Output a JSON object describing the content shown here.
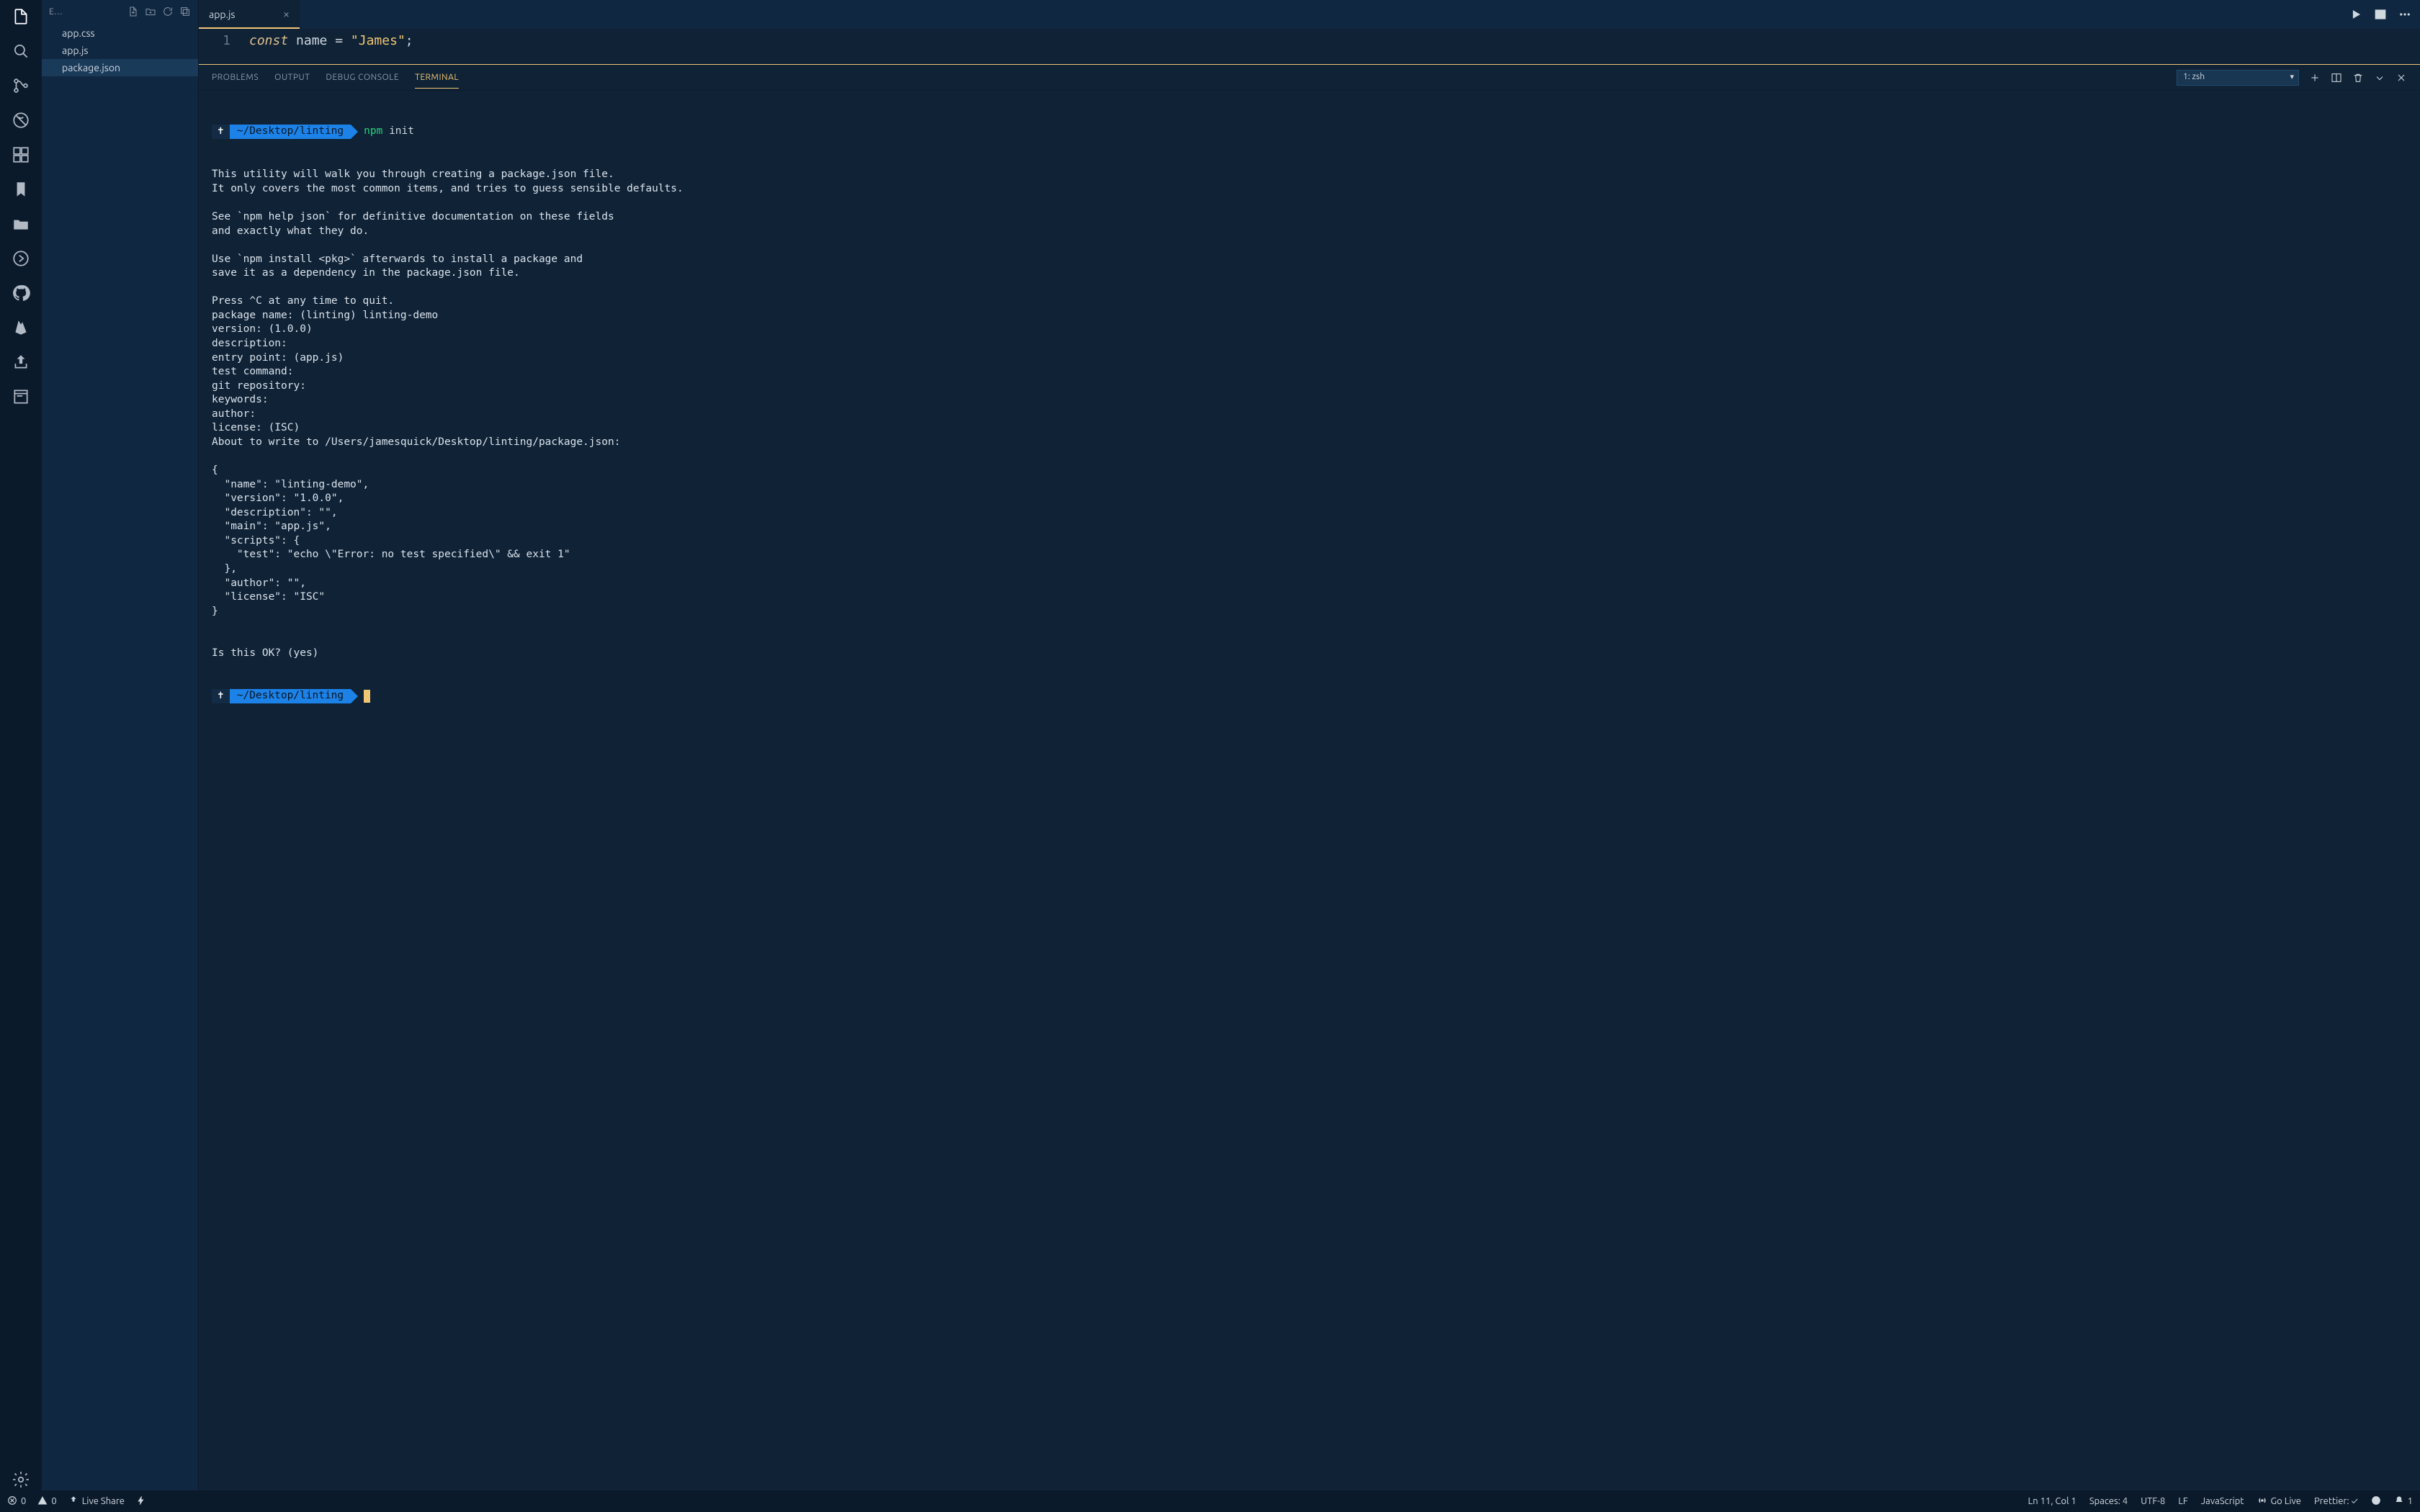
{
  "explorer": {
    "title": "E…",
    "files": [
      "app.css",
      "app.js",
      "package.json"
    ],
    "selected_index": 2
  },
  "tabs": {
    "active": {
      "label": "app.js"
    }
  },
  "editor": {
    "line_number": "1",
    "tokens": {
      "keyword": "const",
      "varname": "name",
      "op1": " = ",
      "string": "\"James\"",
      "semi": ";"
    }
  },
  "panel": {
    "tabs": {
      "problems": "PROBLEMS",
      "output": "OUTPUT",
      "debug_console": "DEBUG CONSOLE",
      "terminal": "TERMINAL"
    },
    "terminal_selector": "1: zsh"
  },
  "terminal": {
    "prompt_symbol": "✝",
    "prompt_path": "~/Desktop/linting",
    "cmd_bin": "npm",
    "cmd_arg": "init",
    "body": "This utility will walk you through creating a package.json file.\nIt only covers the most common items, and tries to guess sensible defaults.\n\nSee `npm help json` for definitive documentation on these fields\nand exactly what they do.\n\nUse `npm install <pkg>` afterwards to install a package and\nsave it as a dependency in the package.json file.\n\nPress ^C at any time to quit.\npackage name: (linting) linting-demo\nversion: (1.0.0) \ndescription: \nentry point: (app.js) \ntest command: \ngit repository: \nkeywords: \nauthor: \nlicense: (ISC) \nAbout to write to /Users/jamesquick/Desktop/linting/package.json:\n\n{\n  \"name\": \"linting-demo\",\n  \"version\": \"1.0.0\",\n  \"description\": \"\",\n  \"main\": \"app.js\",\n  \"scripts\": {\n    \"test\": \"echo \\\"Error: no test specified\\\" && exit 1\"\n  },\n  \"author\": \"\",\n  \"license\": \"ISC\"\n}\n\n\nIs this OK? (yes) "
  },
  "status": {
    "errors": "0",
    "warnings": "0",
    "live_share": "Live Share",
    "ln_col": "Ln 11, Col 1",
    "spaces": "Spaces: 4",
    "encoding": "UTF-8",
    "eol": "LF",
    "language": "JavaScript",
    "go_live": "Go Live",
    "prettier": "Prettier: ✓",
    "bell": "1"
  }
}
